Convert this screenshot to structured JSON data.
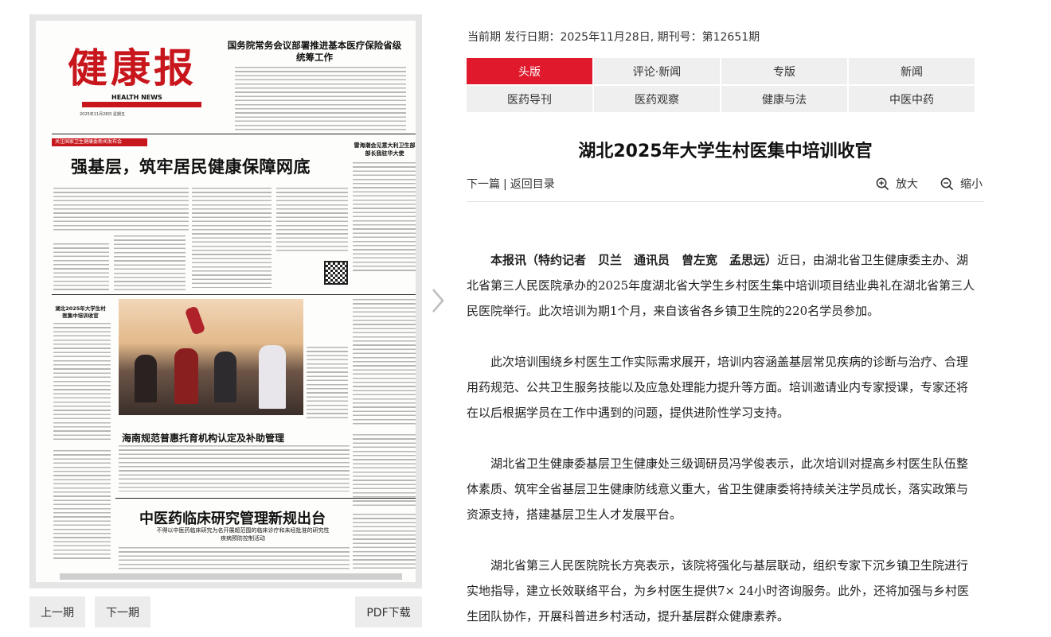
{
  "issue": {
    "info": "当前期 发行日期：2025年11月28日, 期刊号：第12651期"
  },
  "tabs": [
    [
      {
        "label": "头版",
        "active": true
      },
      {
        "label": "评论·新闻",
        "active": false
      },
      {
        "label": "专版",
        "active": false
      },
      {
        "label": "新闻",
        "active": false
      }
    ],
    [
      {
        "label": "医药导刊",
        "active": false
      },
      {
        "label": "医药观察",
        "active": false
      },
      {
        "label": "健康与法",
        "active": false
      },
      {
        "label": "中医中药",
        "active": false
      }
    ]
  ],
  "article": {
    "title": "湖北2025年大学生村医集中培训收官",
    "nav": {
      "next_label": "下一篇",
      "separator": "|",
      "back_label": "返回目录"
    },
    "zoom_in_label": "放大",
    "zoom_out_label": "缩小",
    "byline": "本报讯（特约记者　贝兰　通讯员　曾左宽　孟思远）",
    "paragraphs": [
      "近日，由湖北省卫生健康委主办、湖北省第三人民医院承办的2025年度湖北省大学生乡村医生集中培训项目结业典礼在湖北省第三人民医院举行。此次培训为期1个月，来自该省各乡镇卫生院的220名学员参加。",
      "此次培训围绕乡村医生工作实际需求展开，培训内容涵盖基层常见疾病的诊断与治疗、合理用药规范、公共卫生服务技能以及应急处理能力提升等方面。培训邀请业内专家授课，专家还将在以后根据学员在工作中遇到的问题，提供进阶性学习支持。",
      "湖北省卫生健康委基层卫生健康处三级调研员冯学俊表示，此次培训对提高乡村医生队伍整体素质、筑牢全省基层卫生健康防线意义重大，省卫生健康委将持续关注学员成长，落实政策与资源支持，搭建基层卫生人才发展平台。",
      "湖北省第三人民医院院长方亮表示，该院将强化与基层联动，组织专家下沉乡镇卫生院进行实地指导，建立长效联络平台，为乡村医生提供7× 24小时咨询服务。此外，还将加强与乡村医生团队协作，开展科普进乡村活动，提升基层群众健康素养。"
    ]
  },
  "newspaper": {
    "logo_text": "健康报",
    "logo_en": "HEALTH NEWS",
    "date_line": "2025年11月28日 星期五",
    "top_headline": "国务院常务会议部署推进基本医疗保险省级统筹工作",
    "tag": "关注国家卫生健康委新闻发布会",
    "banner_headline": "强基层，筑牢居民健康保障网底",
    "side_headline": "雷海潮会见意大利卫生部部长我驻华大使",
    "left_column_title": "湖北2025年大学生村医集中培训收官",
    "mid_headline": "海南规范普惠托育机构认定及补助管理",
    "bottom_headline": "中医药临床研究管理新规出台",
    "bottom_sub": "不得以中医药临床研究为名开展超范围的临床诊疗和未经批准的研究性疾病预防控制活动"
  },
  "pager": {
    "prev_label": "上一期",
    "next_label": "下一期",
    "pdf_label": "PDF下载"
  },
  "colors": {
    "accent_red": "#e0192d",
    "tab_bg": "#efefef",
    "button_bg": "#ececec"
  },
  "icons": {
    "zoom_in": "zoom-in-icon",
    "zoom_out": "zoom-out-icon",
    "next_page": "chevron-right-icon"
  }
}
